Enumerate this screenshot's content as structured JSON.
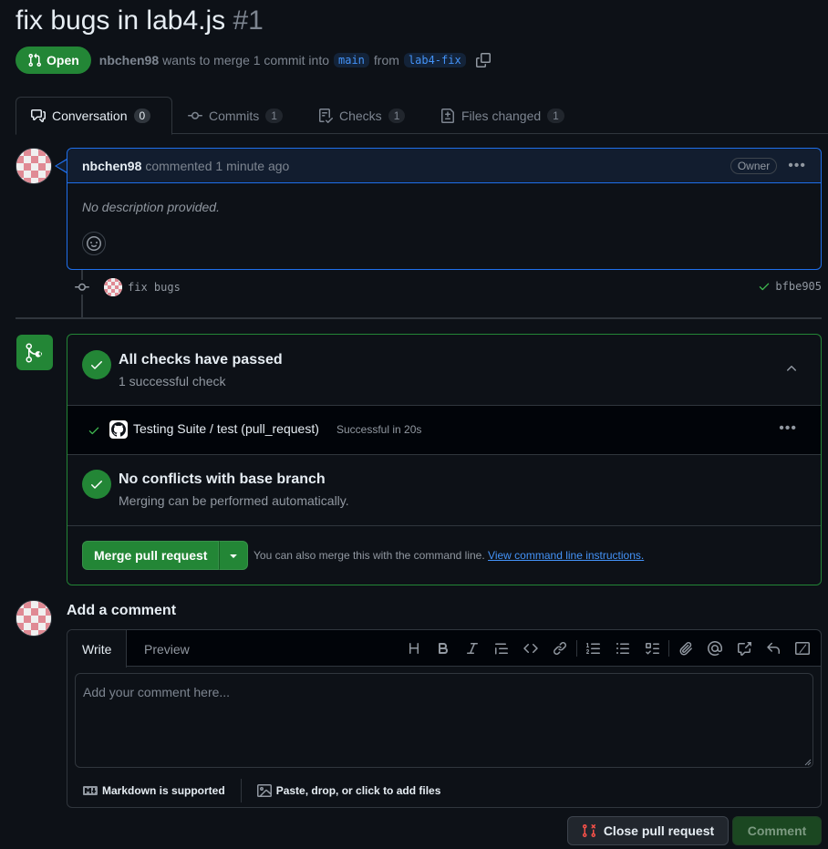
{
  "pr": {
    "title": "fix bugs in lab4.js",
    "number": "#1",
    "state": "Open",
    "author": "nbchen98",
    "merge_text": "wants to merge 1 commit into",
    "base_branch": "main",
    "from_text": "from",
    "head_branch": "lab4-fix"
  },
  "tabs": [
    {
      "label": "Conversation",
      "count": "0"
    },
    {
      "label": "Commits",
      "count": "1"
    },
    {
      "label": "Checks",
      "count": "1"
    },
    {
      "label": "Files changed",
      "count": "1"
    }
  ],
  "comment": {
    "author": "nbchen98",
    "action": "commented 1 minute ago",
    "role": "Owner",
    "body": "No description provided."
  },
  "commit": {
    "message": "fix bugs",
    "sha": "bfbe905"
  },
  "merge": {
    "checks_title": "All checks have passed",
    "checks_sub": "1 successful check",
    "check_name": "Testing Suite / test (pull_request)",
    "check_status": "Successful in 20s",
    "conflicts_title": "No conflicts with base branch",
    "conflicts_sub": "Merging can be performed automatically.",
    "merge_button": "Merge pull request",
    "hint": "You can also merge this with the command line.",
    "hint_link": "View command line instructions."
  },
  "add_comment": {
    "title": "Add a comment",
    "tab_write": "Write",
    "tab_preview": "Preview",
    "placeholder": "Add your comment here...",
    "markdown": "Markdown is supported",
    "attach": "Paste, drop, or click to add files"
  },
  "actions": {
    "close": "Close pull request",
    "comment": "Comment"
  },
  "colors": {
    "accent_green": "#238636",
    "accent_blue": "#4493f8",
    "background": "#0d1117"
  }
}
